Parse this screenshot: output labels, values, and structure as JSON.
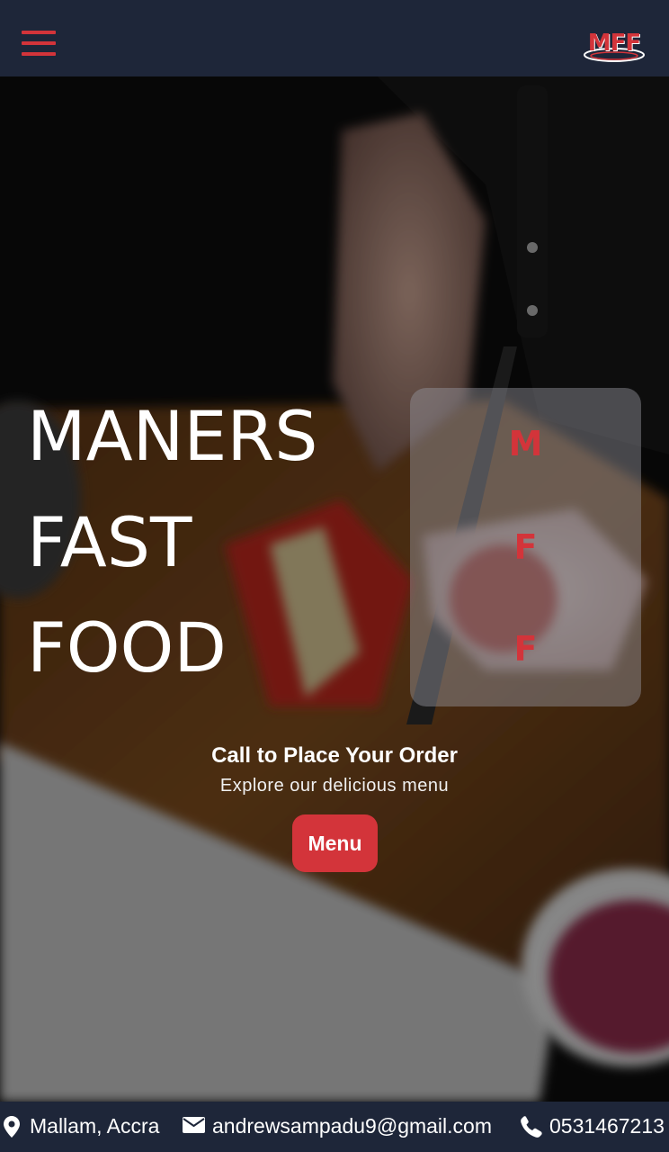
{
  "header": {
    "menu_icon": "hamburger-icon",
    "logo_text": "MFF",
    "accent_color": "#d3343a",
    "bar_color": "#1e2639"
  },
  "hero": {
    "title_lines": [
      "MANERS",
      "FAST",
      "FOOD"
    ],
    "side_letters": [
      "M",
      "F",
      "F"
    ],
    "cta_title": "Call to Place Your Order",
    "cta_subtitle": "Explore our delicious menu",
    "menu_button_label": "Menu"
  },
  "footer": {
    "location_icon": "map-pin-icon",
    "location": "Mallam, Accra",
    "email_icon": "envelope-icon",
    "email": "andrewsampadu9@gmail.com",
    "phone_icon": "phone-icon",
    "phone": "0531467213"
  }
}
